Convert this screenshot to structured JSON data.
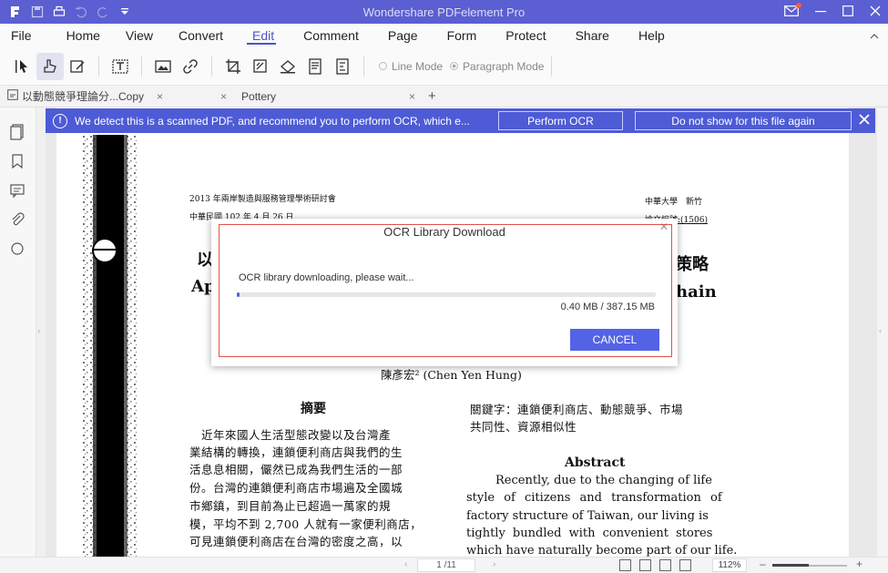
{
  "window": {
    "title": "Wondershare PDFelement Pro"
  },
  "menu": {
    "items": [
      "File",
      "Home",
      "View",
      "Convert",
      "Edit",
      "Comment",
      "Page",
      "Form",
      "Protect",
      "Share",
      "Help"
    ],
    "active": "Edit"
  },
  "toolbar": {
    "line_mode": "Line Mode",
    "paragraph_mode": "Paragraph Mode"
  },
  "tabs": [
    {
      "label": "以動態競爭理論分...Copy"
    },
    {
      "label": "Pottery"
    }
  ],
  "banner": {
    "message": "We detect this is a scanned PDF, and recommend you to perform OCR, which e...",
    "perform_ocr": "Perform OCR",
    "do_not_show": "Do not show for this file again"
  },
  "document": {
    "header_left_1": "2013 年兩岸製造與服務管理學術研討會",
    "header_left_2": "中華民國 102 年 4 月 26 日",
    "header_right_1": "中華大學　新竹",
    "header_right_2": "論文編號:(1506)",
    "title_frag_left": "以",
    "title_frag_right": "策略",
    "title_en_left": "Ap",
    "title_en_right": "hain",
    "author": "陳彥宏² (Chen Yen Hung)",
    "abstract_cn_title": "摘要",
    "abstract_cn_lines": [
      "　近年來國人生活型態改變以及台灣產",
      "業結構的轉換，連鎖便利商店與我們的生",
      "活息息相關，儼然已成為我們生活的一部",
      "份。台灣的連鎖便利商店市場遍及全國城",
      "市鄉鎮，到目前為止已超過一萬家的規",
      "模，平均不到 2,700 人就有一家便利商店，",
      "可見連鎖便利商店在台灣的密度之高，以"
    ],
    "keywords_lines": [
      "關鍵字：連鎖便利商店、動態競爭、市場",
      "共同性、資源相似性"
    ],
    "abstract_en_title": "Abstract",
    "abstract_en_lines": [
      "Recently, due to the changing of life",
      "style of citizens and transformation of",
      "factory structure of Taiwan, our living is",
      "tightly bundled with convenient stores",
      "which have naturally become part of our life."
    ]
  },
  "dialog": {
    "title": "OCR Library Download",
    "message": "OCR library downloading, please wait...",
    "size": "0.40 MB / 387.15 MB",
    "progress_fraction": 0.001,
    "cancel": "CANCEL"
  },
  "status": {
    "page": "1 /11",
    "zoom": "112%",
    "zoom_minus": "–",
    "zoom_plus": "+"
  },
  "colors": {
    "titlebar": "#5b5fd1",
    "accent": "#4d5bd6",
    "cancel_button": "#5463e6",
    "dialog_highlight": "#e0524a"
  }
}
